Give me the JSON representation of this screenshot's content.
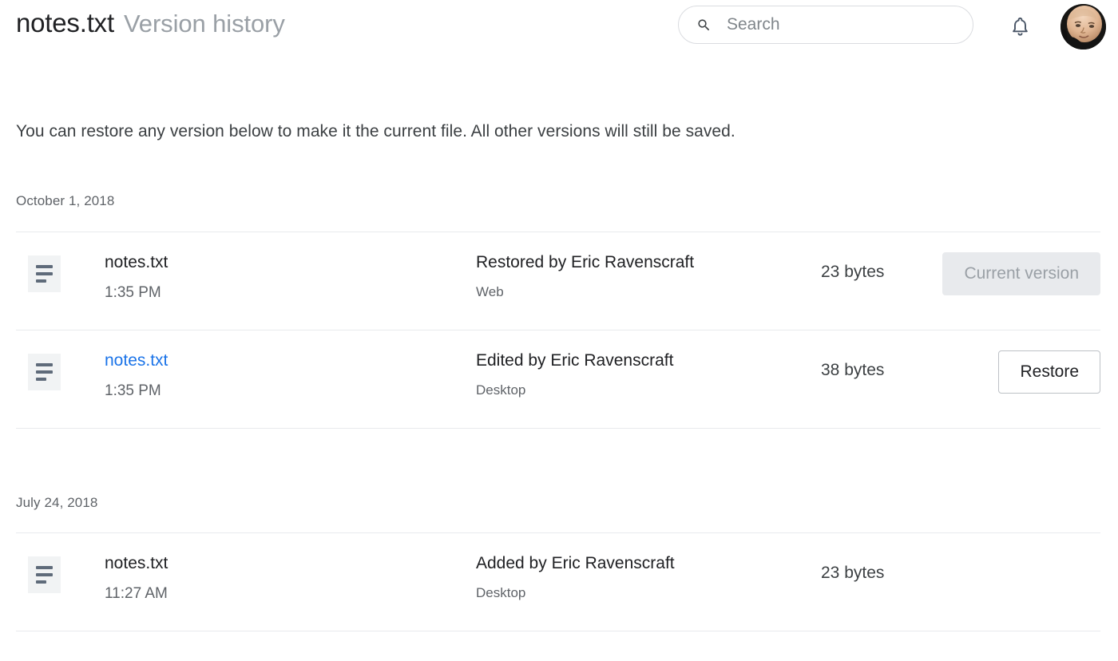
{
  "header": {
    "file_title": "notes.txt",
    "page_subtitle": "Version history",
    "search": {
      "placeholder": "Search",
      "value": "",
      "icon": "search-icon"
    },
    "notifications_icon": "bell-icon",
    "avatar_label": "account-avatar"
  },
  "description": "You can restore any version below to make it the current file. All other versions will still be saved.",
  "groups": [
    {
      "date": "October 1, 2018",
      "rows": [
        {
          "icon": "text-file-icon",
          "name": "notes.txt",
          "name_is_link": false,
          "time": "1:35 PM",
          "action": "Restored by Eric Ravenscraft",
          "source": "Web",
          "size": "23 bytes",
          "button": "Current version",
          "button_state": "disabled"
        },
        {
          "icon": "text-file-icon",
          "name": "notes.txt",
          "name_is_link": true,
          "time": "1:35 PM",
          "action": "Edited by Eric Ravenscraft",
          "source": "Desktop",
          "size": "38 bytes",
          "button": "Restore",
          "button_state": "enabled"
        }
      ]
    },
    {
      "date": "July 24, 2018",
      "rows": [
        {
          "icon": "text-file-icon",
          "name": "notes.txt",
          "name_is_link": false,
          "time": "11:27 AM",
          "action": "Added by Eric Ravenscraft",
          "source": "Desktop",
          "size": "23 bytes",
          "button": "",
          "button_state": "none"
        }
      ]
    }
  ],
  "colors": {
    "link": "#1a73e8",
    "text_primary": "#202124",
    "text_secondary": "#5f6368",
    "text_muted": "#9aa0a6",
    "divider": "#e8eaed",
    "icon_bg": "#f1f3f4"
  }
}
